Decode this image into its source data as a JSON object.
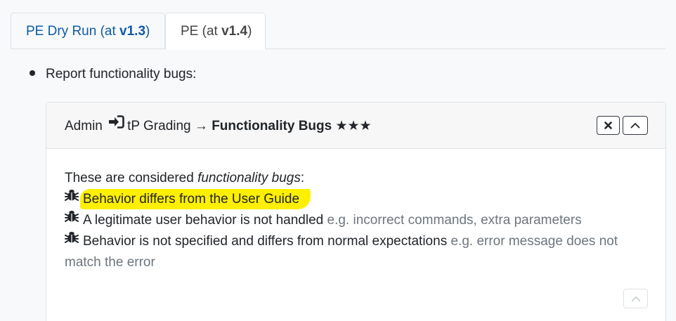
{
  "tabs": [
    {
      "prefix": "PE Dry Run (at ",
      "version": "v1.3",
      "suffix": ")"
    },
    {
      "prefix": "PE (at ",
      "version": "v1.4",
      "suffix": ")"
    }
  ],
  "bullet": {
    "text": "Report functionality bugs:"
  },
  "panel": {
    "title_prefix": "Admin",
    "title_mid": "tP Grading → ",
    "title_bold": "Functionality Bugs",
    "stars": "★★★",
    "intro_prefix": "These are considered ",
    "intro_em": "functionality bugs",
    "intro_suffix": ":",
    "items": [
      {
        "main": "Behavior differs from the User Guide",
        "note": ""
      },
      {
        "main": "A legitimate user behavior is not handled",
        "note": "e.g. incorrect commands, extra parameters"
      },
      {
        "main": "Behavior is not specified and differs from normal expectations",
        "note": "e.g. error message does not match the error"
      }
    ],
    "highlight_color": "#ffef00"
  }
}
